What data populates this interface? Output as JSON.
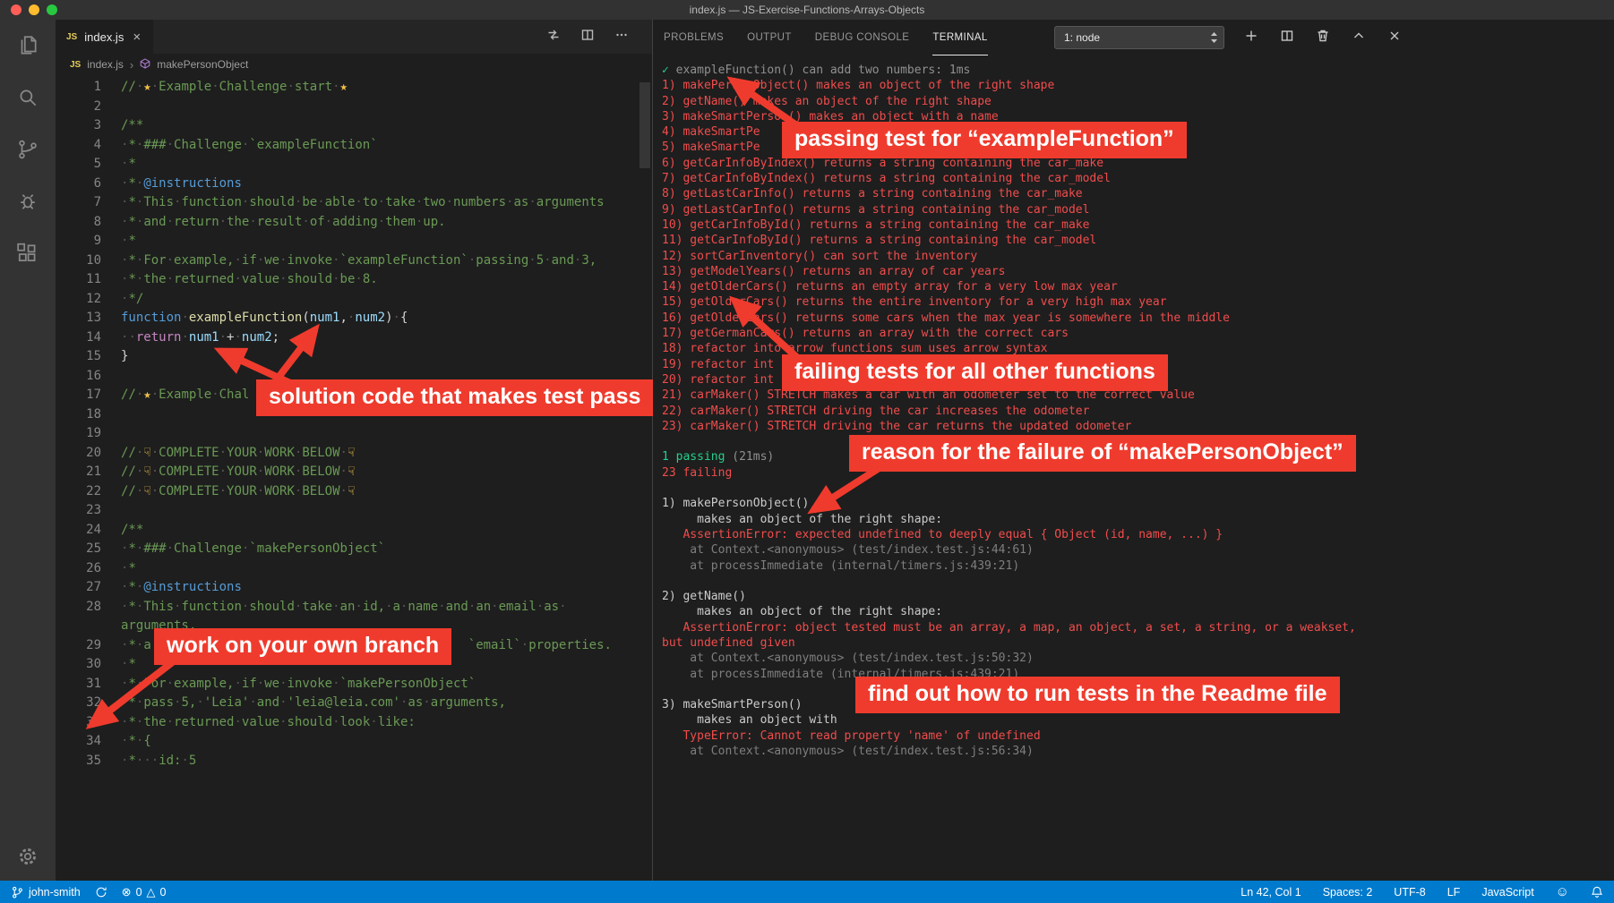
{
  "window": {
    "title": "index.js — JS-Exercise-Functions-Arrays-Objects"
  },
  "activity_bar": {
    "items": [
      "explorer",
      "search",
      "source-control",
      "run-debug",
      "extensions"
    ],
    "bottom": [
      "settings"
    ]
  },
  "editor": {
    "tab": {
      "icon_text": "JS",
      "label": "index.js"
    },
    "breadcrumb": {
      "file": "index.js",
      "separator": "›",
      "symbol": "makePersonObject"
    },
    "lines": [
      {
        "n": 1,
        "s": [
          [
            "cm",
            "//·"
          ],
          [
            "star",
            "★"
          ],
          [
            "cm",
            "·Example·Challenge·start·"
          ],
          [
            "star",
            "★"
          ]
        ]
      },
      {
        "n": 2,
        "s": []
      },
      {
        "n": 3,
        "s": [
          [
            "cm",
            "/**"
          ]
        ]
      },
      {
        "n": 4,
        "s": [
          [
            "cm",
            "·*·###·Challenge·`exampleFunction`"
          ]
        ]
      },
      {
        "n": 5,
        "s": [
          [
            "cm",
            "·*"
          ]
        ]
      },
      {
        "n": 6,
        "s": [
          [
            "cm",
            "·*·"
          ],
          [
            "tag",
            "@instructions"
          ]
        ]
      },
      {
        "n": 7,
        "s": [
          [
            "cm",
            "·*·This·function·should·be·able·to·take·two·numbers·as·arguments"
          ]
        ]
      },
      {
        "n": 8,
        "s": [
          [
            "cm",
            "·*·and·return·the·result·of·adding·them·up."
          ]
        ]
      },
      {
        "n": 9,
        "s": [
          [
            "cm",
            "·*"
          ]
        ]
      },
      {
        "n": 10,
        "s": [
          [
            "cm",
            "·*·For·example,·if·we·invoke·`exampleFunction`·passing·5·and·3,"
          ]
        ]
      },
      {
        "n": 11,
        "s": [
          [
            "cm",
            "·*·the·returned·value·should·be·8."
          ]
        ]
      },
      {
        "n": 12,
        "s": [
          [
            "cm",
            "·*/"
          ]
        ]
      },
      {
        "n": 13,
        "s": [
          [
            "kw",
            "function"
          ],
          [
            "pl",
            "·"
          ],
          [
            "fn",
            "exampleFunction"
          ],
          [
            "pu",
            "("
          ],
          [
            "va",
            "num1"
          ],
          [
            "pu",
            ","
          ],
          [
            "pl",
            "·"
          ],
          [
            "va",
            "num2"
          ],
          [
            "pu",
            ")"
          ],
          [
            "pl",
            "·"
          ],
          [
            "pu",
            "{"
          ]
        ]
      },
      {
        "n": 14,
        "s": [
          [
            "pl",
            "··"
          ],
          [
            "ct",
            "return"
          ],
          [
            "pl",
            "·"
          ],
          [
            "va",
            "num1"
          ],
          [
            "pl",
            "·"
          ],
          [
            "op",
            "+"
          ],
          [
            "pl",
            "·"
          ],
          [
            "va",
            "num2"
          ],
          [
            "pu",
            ";"
          ]
        ]
      },
      {
        "n": 15,
        "s": [
          [
            "pu",
            "}"
          ]
        ]
      },
      {
        "n": 16,
        "s": []
      },
      {
        "n": 17,
        "s": [
          [
            "cm",
            "//·"
          ],
          [
            "star",
            "★"
          ],
          [
            "cm",
            "·Example·Chal"
          ]
        ]
      },
      {
        "n": 18,
        "s": []
      },
      {
        "n": 19,
        "s": []
      },
      {
        "n": 20,
        "s": [
          [
            "cm",
            "//·"
          ],
          [
            "hand",
            "☟"
          ],
          [
            "cm",
            "·COMPLETE·YOUR·WORK·BELOW·"
          ],
          [
            "hand",
            "☟"
          ]
        ]
      },
      {
        "n": 21,
        "s": [
          [
            "cm",
            "//·"
          ],
          [
            "hand",
            "☟"
          ],
          [
            "cm",
            "·COMPLETE·YOUR·WORK·BELOW·"
          ],
          [
            "hand",
            "☟"
          ]
        ]
      },
      {
        "n": 22,
        "s": [
          [
            "cm",
            "//·"
          ],
          [
            "hand",
            "☟"
          ],
          [
            "cm",
            "·COMPLETE·YOUR·WORK·BELOW·"
          ],
          [
            "hand",
            "☟"
          ]
        ]
      },
      {
        "n": 23,
        "s": []
      },
      {
        "n": 24,
        "s": [
          [
            "cm",
            "/**"
          ]
        ]
      },
      {
        "n": 25,
        "s": [
          [
            "cm",
            "·*·###·Challenge·`makePersonObject`"
          ]
        ]
      },
      {
        "n": 26,
        "s": [
          [
            "cm",
            "·*"
          ]
        ]
      },
      {
        "n": 27,
        "s": [
          [
            "cm",
            "·*·"
          ],
          [
            "tag",
            "@instructions"
          ]
        ]
      },
      {
        "n": 28,
        "s": [
          [
            "cm",
            "·*·This·function·should·take·an·id,·a·name·and·an·email·as·\narguments,"
          ]
        ]
      },
      {
        "n": 29,
        "s": [
          [
            "cm",
            "·*·a"
          ],
          [
            "pl",
            "                                          "
          ],
          [
            "cm",
            "`email`·properties."
          ]
        ]
      },
      {
        "n": 30,
        "s": [
          [
            "cm",
            "·*"
          ]
        ]
      },
      {
        "n": 31,
        "s": [
          [
            "cm",
            "·*·For·example,·if·we·invoke·`makePersonObject`"
          ]
        ]
      },
      {
        "n": 32,
        "s": [
          [
            "cm",
            "·*·pass·5,·'Leia'·and·'leia@leia.com'·as·arguments,"
          ]
        ]
      },
      {
        "n": 33,
        "s": [
          [
            "cm",
            "·*·the·returned·value·should·look·like:"
          ]
        ]
      },
      {
        "n": 34,
        "s": [
          [
            "cm",
            "·*·{"
          ]
        ]
      },
      {
        "n": 35,
        "s": [
          [
            "cm",
            "·*···id:·5"
          ]
        ]
      }
    ]
  },
  "panel": {
    "tabs": [
      "PROBLEMS",
      "OUTPUT",
      "DEBUG CONSOLE",
      "TERMINAL"
    ],
    "active_tab": "TERMINAL",
    "shell_selector": "1: node",
    "terminal_lines": [
      [
        [
          "g",
          "✓ "
        ],
        [
          "d",
          "exampleFunction() can add two numbers: 1ms"
        ]
      ],
      [
        [
          "r",
          "1) makePersonObject() makes an object of the right shape"
        ]
      ],
      [
        [
          "r",
          "2) getName() makes an object of the right shape"
        ]
      ],
      [
        [
          "r",
          "3) makeSmartPerson() makes an object with a name"
        ]
      ],
      [
        [
          "r",
          "4) makeSmartPe"
        ]
      ],
      [
        [
          "r",
          "5) makeSmartPe"
        ]
      ],
      [
        [
          "r",
          "6) getCarInfoByIndex() returns a string containing the car_make"
        ]
      ],
      [
        [
          "r",
          "7) getCarInfoByIndex() returns a string containing the car_model"
        ]
      ],
      [
        [
          "r",
          "8) getLastCarInfo() returns a string containing the car_make"
        ]
      ],
      [
        [
          "r",
          "9) getLastCarInfo() returns a string containing the car_model"
        ]
      ],
      [
        [
          "r",
          "10) getCarInfoById() returns a string containing the car_make"
        ]
      ],
      [
        [
          "r",
          "11) getCarInfoById() returns a string containing the car_model"
        ]
      ],
      [
        [
          "r",
          "12) sortCarInventory() can sort the inventory"
        ]
      ],
      [
        [
          "r",
          "13) getModelYears() returns an array of car years"
        ]
      ],
      [
        [
          "r",
          "14) getOlderCars() returns an empty array for a very low max year"
        ]
      ],
      [
        [
          "r",
          "15) getOlderCars() returns the entire inventory for a very high max year"
        ]
      ],
      [
        [
          "r",
          "16) getOlderCars() returns some cars when the max year is somewhere in the middle"
        ]
      ],
      [
        [
          "r",
          "17) getGermanCars() returns an array with the correct cars"
        ]
      ],
      [
        [
          "r",
          "18) refactor into arrow functions sum uses arrow syntax"
        ]
      ],
      [
        [
          "r",
          "19) refactor int"
        ]
      ],
      [
        [
          "r",
          "20) refactor int"
        ]
      ],
      [
        [
          "r",
          "21) carMaker() STRETCH makes a car with an odometer set to the correct value"
        ]
      ],
      [
        [
          "r",
          "22) carMaker() STRETCH driving the car increases the odometer"
        ]
      ],
      [
        [
          "r",
          "23) carMaker() STRETCH driving the car returns the updated odometer"
        ]
      ],
      [],
      [
        [
          "g",
          "1 passing"
        ],
        [
          "d",
          " (21ms)"
        ]
      ],
      [
        [
          "r",
          "23 failing"
        ]
      ],
      [],
      [
        [
          "w",
          "1) makePersonObject()"
        ]
      ],
      [
        [
          "w",
          "     makes an object of the right shape:"
        ]
      ],
      [
        [
          "r",
          "   AssertionError: expected undefined to deeply equal { Object (id, name, ...) }"
        ]
      ],
      [
        [
          "s",
          "    at Context.<anonymous> (test/index.test.js:44:61)"
        ]
      ],
      [
        [
          "s",
          "    at processImmediate (internal/timers.js:439:21)"
        ]
      ],
      [],
      [
        [
          "w",
          "2) getName()"
        ]
      ],
      [
        [
          "w",
          "     makes an object of the right shape:"
        ]
      ],
      [
        [
          "r",
          "   AssertionError: object tested must be an array, a map, an object, a set, a string, or a weakset,"
        ]
      ],
      [
        [
          "r",
          "but undefined given"
        ]
      ],
      [
        [
          "s",
          "    at Context.<anonymous> (test/index.test.js:50:32)"
        ]
      ],
      [
        [
          "s",
          "    at processImmediate (internal/timers.js:439:21)"
        ]
      ],
      [],
      [
        [
          "w",
          "3) makeSmartPerson()"
        ]
      ],
      [
        [
          "w",
          "     makes an object with"
        ]
      ],
      [
        [
          "r",
          "   TypeError: Cannot read property 'name' of undefined"
        ]
      ],
      [
        [
          "s",
          "    at Context.<anonymous> (test/index.test.js:56:34)"
        ]
      ]
    ]
  },
  "annotations": [
    "passing test for “exampleFunction”",
    "failing tests for all other functions",
    "reason for the failure of “makePersonObject”",
    "solution code that makes test pass",
    "work on your own branch",
    "find out how to run tests in the Readme file"
  ],
  "status_bar": {
    "branch": "john-smith",
    "errors": "0",
    "warnings": "0",
    "line_col": "Ln 42, Col 1",
    "indent": "Spaces: 2",
    "encoding": "UTF-8",
    "eol": "LF",
    "language": "JavaScript"
  },
  "colors": {
    "status_bar": "#007acc",
    "annotation_red": "#ef3b2d",
    "terminal_fail_red": "#f14c4c",
    "terminal_pass_green": "#23d18b",
    "comment_green": "#6a9955",
    "titlebar": "#323233",
    "activity_bar": "#333333",
    "editor_background": "#1e1e1e"
  }
}
